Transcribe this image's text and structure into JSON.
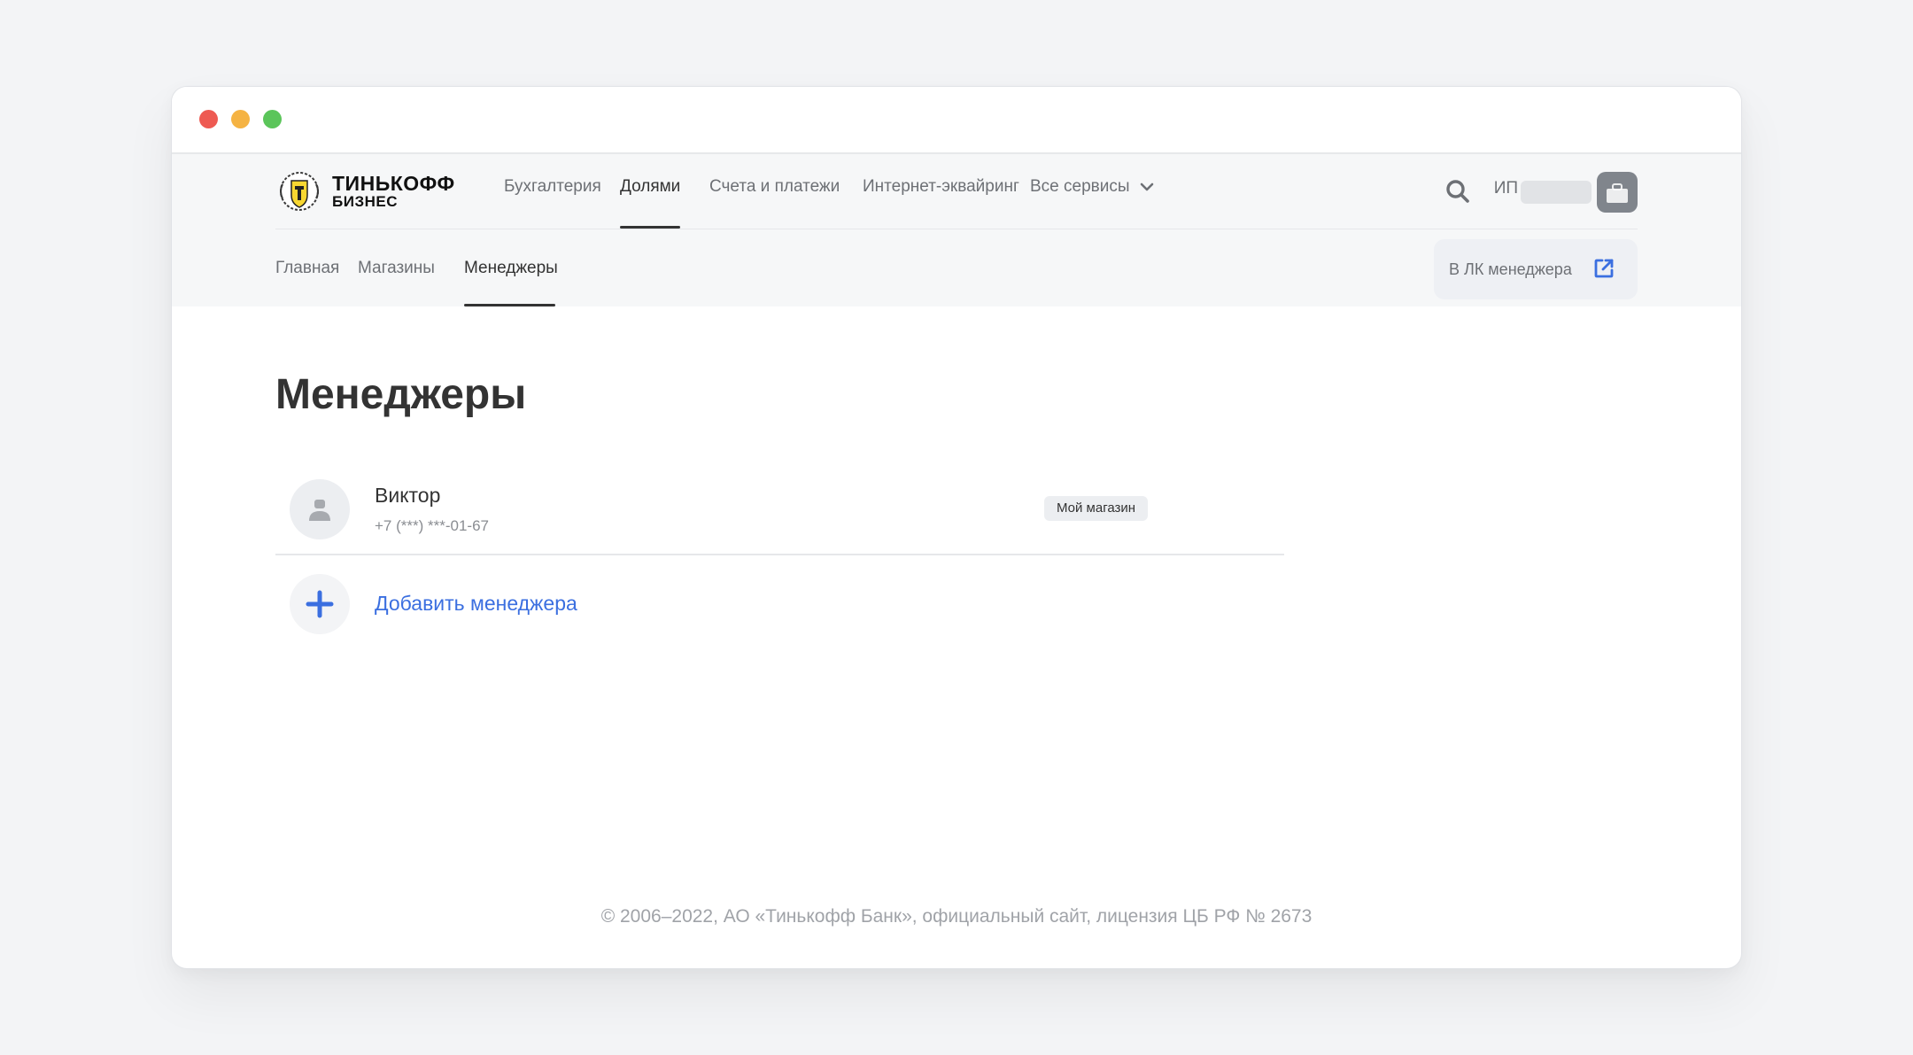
{
  "brand": {
    "name_line1": "ТИНЬКОФФ",
    "name_line2": "БИЗНЕС",
    "logo_color": "#f8d731"
  },
  "topnav": {
    "items": [
      {
        "label": "Бухгалтерия",
        "active": false
      },
      {
        "label": "Долями",
        "active": true
      },
      {
        "label": "Счета и платежи",
        "active": false
      },
      {
        "label": "Интернет-эквайринг",
        "active": false
      },
      {
        "label": "Все сервисы",
        "active": false,
        "dropdown": true
      }
    ],
    "account_prefix": "ИП"
  },
  "subnav": {
    "items": [
      {
        "label": "Главная",
        "active": false
      },
      {
        "label": "Магазины",
        "active": false
      },
      {
        "label": "Менеджеры",
        "active": true
      }
    ],
    "lk_button_label": "В ЛК менеджера"
  },
  "page": {
    "title": "Менеджеры"
  },
  "managers": [
    {
      "name": "Виктор",
      "phone": "+7 (***) ***-01-67",
      "store": "Мой магазин"
    }
  ],
  "add_manager_label": "Добавить менеджера",
  "footer": {
    "text": "© 2006–2022, АО «Тинькофф Банк», официальный сайт, лицензия ЦБ РФ № 2673"
  },
  "colors": {
    "accent_link": "#3b6fe0",
    "text_primary": "#333333",
    "text_secondary": "#6d7075"
  }
}
